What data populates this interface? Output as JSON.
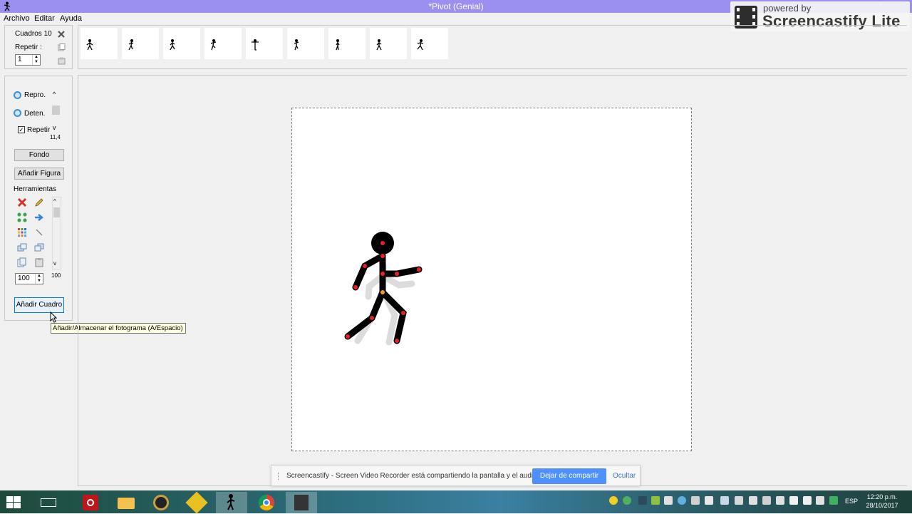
{
  "window": {
    "title": "*Pivot (Genial)"
  },
  "watermark": {
    "small": "powered by",
    "big": "Screencastify Lite"
  },
  "menu": {
    "items": [
      "Archivo",
      "Editar",
      "Ayuda"
    ]
  },
  "frames_panel": {
    "count_label": "Cuadros 10",
    "repeat_label": "Repetir :",
    "repeat_value": "1"
  },
  "frames": {
    "count": 9
  },
  "controls": {
    "play_label": "Repro.",
    "stop_label": "Deten.",
    "loop_label": "Repetir",
    "loop_checked": true,
    "speed_readout": "11,4",
    "background_button": "Fondo",
    "add_figure_button": "Añadir Figura",
    "tools_label": "Herramientas",
    "scale_value": "100",
    "scale_readout": "100",
    "add_frame_button": "Añadir Cuadro"
  },
  "tooltip": {
    "text": "Añadir/Almacenar el fotograma (A/Espacio)"
  },
  "share_bar": {
    "message": "Screencastify - Screen Video Recorder está compartiendo la pantalla y el audio.",
    "stop_button": "Dejar de compartir",
    "hide_link": "Ocultar"
  },
  "taskbar": {
    "language": "ESP",
    "time": "12:20 p.m.",
    "date": "28/10/2017",
    "apps": [
      "start-icon",
      "keyboard-icon",
      "power-icon",
      "file-explorer-icon",
      "speaker-icon",
      "app-icon",
      "pivot-icon",
      "chrome-icon",
      "film-icon"
    ]
  },
  "colors": {
    "title_bar": "#9b8ff0",
    "accent": "#4d90fe",
    "joint": "#e8202a"
  }
}
